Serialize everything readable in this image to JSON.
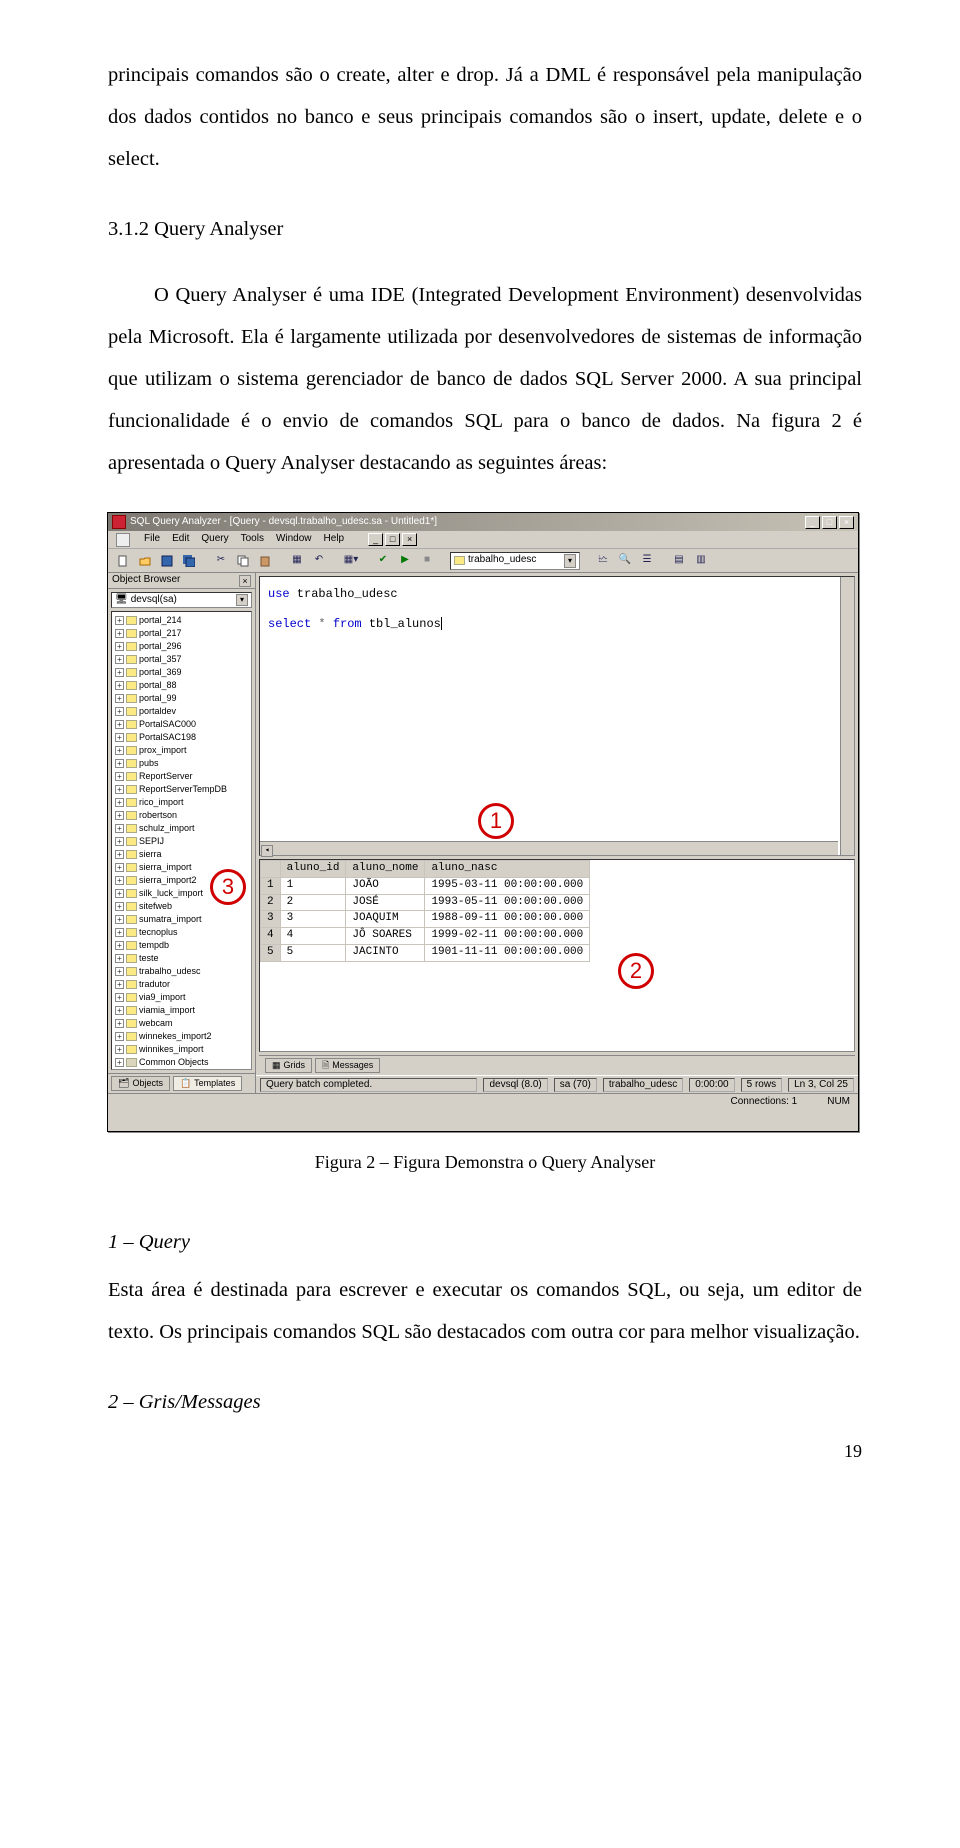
{
  "paragraphs": {
    "intro": "principais comandos são o create, alter e drop. Já a DML é responsável pela manipulação dos dados contidos no banco e seus principais comandos são o insert, update, delete e o select.",
    "heading_312": "3.1.2 Query Analyser",
    "qa_desc": "O Query Analyser é uma IDE (Integrated Development Environment) desenvolvidas pela Microsoft. Ela é largamente utilizada por desenvolvedores de sistemas de informação que utilizam o sistema gerenciador de banco de dados SQL Server 2000. A sua principal funcionalidade é o envio de comandos SQL para o banco de dados. Na figura 2 é apresentada o Query Analyser destacando as seguintes áreas:",
    "fig_caption": "Figura 2 – Figura Demonstra o Query Analyser",
    "sec1_label": "1 – Query",
    "sec1_body": "Esta área é destinada para escrever e executar os comandos SQL, ou seja, um editor de texto. Os principais comandos SQL são destacados com outra cor para melhor visualização.",
    "sec2_label": "2 – Gris/Messages",
    "page_number": "19"
  },
  "window": {
    "title": "SQL Query Analyzer - [Query - devsql.trabalho_udesc.sa - Untitled1*]",
    "menu": [
      "File",
      "Edit",
      "Query",
      "Tools",
      "Window",
      "Help"
    ],
    "db_selected": "trabalho_udesc",
    "object_browser": {
      "title": "Object Browser",
      "server": "devsql(sa)",
      "items": [
        "portal_214",
        "portal_217",
        "portal_296",
        "portal_357",
        "portal_369",
        "portal_88",
        "portal_99",
        "portaldev",
        "PortalSAC000",
        "PortalSAC198",
        "prox_import",
        "pubs",
        "ReportServer",
        "ReportServerTempDB",
        "rico_import",
        "robertson",
        "schulz_import",
        "SEPIJ",
        "sierra",
        "sierra_import",
        "sierra_import2",
        "silk_luck_import",
        "sitefweb",
        "sumatra_import",
        "tecnoplus",
        "tempdb",
        "teste",
        "trabalho_udesc",
        "tradutor",
        "via9_import",
        "viamia_import",
        "webcam",
        "winnekes_import2",
        "winnikes_import"
      ],
      "last_item": "Common Objects",
      "tabs": [
        "Objects",
        "Templates"
      ]
    },
    "editor": {
      "line1a": "use",
      "line1b": " trabalho_udesc",
      "line2a": "select",
      "line2b": " * ",
      "line2c": "from",
      "line2d": " tbl_alunos"
    },
    "grid": {
      "cols": [
        "aluno_id",
        "aluno_nome",
        "aluno_nasc"
      ],
      "rows": [
        [
          "1",
          "JOÃO",
          "1995-03-11 00:00:00.000"
        ],
        [
          "2",
          "JOSÉ",
          "1993-05-11 00:00:00.000"
        ],
        [
          "3",
          "JOAQUIM",
          "1988-09-11 00:00:00.000"
        ],
        [
          "4",
          "JÔ SOARES",
          "1999-02-11 00:00:00.000"
        ],
        [
          "5",
          "JACINTO",
          "1901-11-11 00:00:00.000"
        ]
      ],
      "tabs": [
        "Grids",
        "Messages"
      ]
    },
    "status": {
      "msg": "Query batch completed.",
      "server": "devsql (8.0)",
      "user": "sa (70)",
      "db": "trabalho_udesc",
      "time": "0:00:00",
      "rows": "5 rows",
      "pos": "Ln 3, Col 25",
      "conn": "Connections: 1",
      "num": "NUM"
    },
    "annotations": {
      "a1": "1",
      "a2": "2",
      "a3": "3"
    }
  }
}
